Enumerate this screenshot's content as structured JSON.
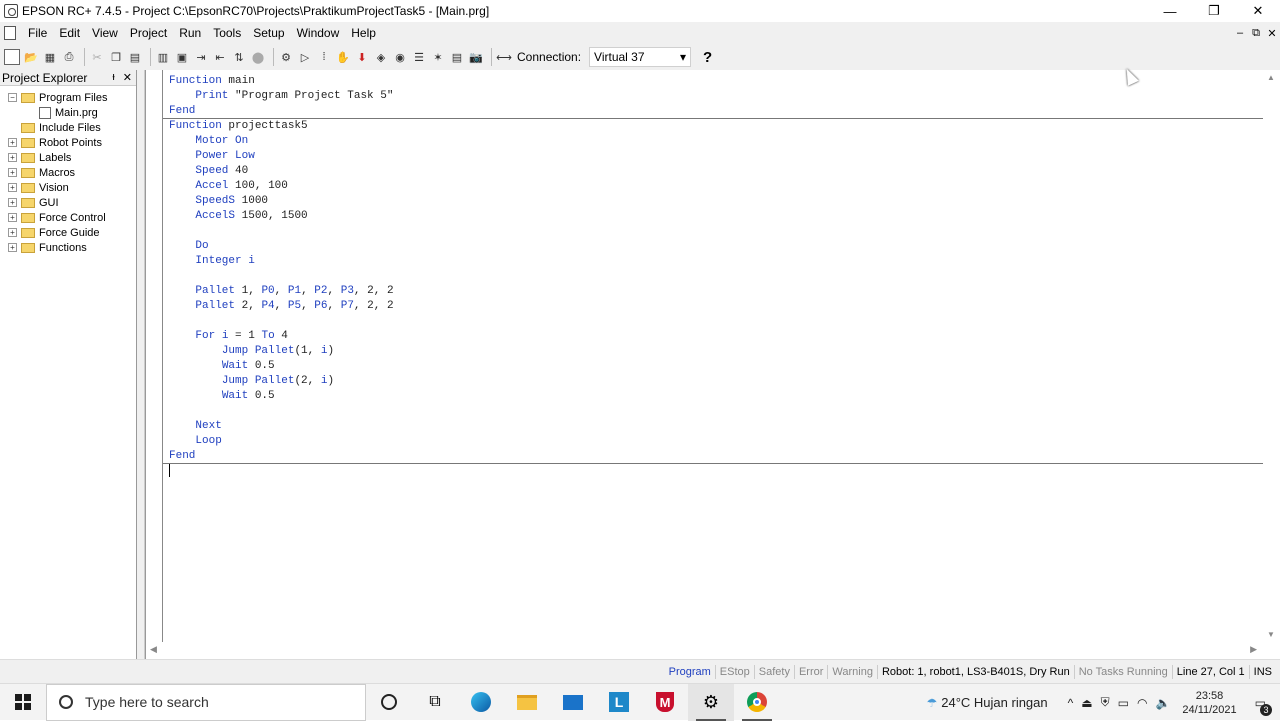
{
  "window": {
    "title": "EPSON RC+ 7.4.5 - Project C:\\EpsonRC70\\Projects\\PraktikumProjectTask5 - [Main.prg]",
    "controls": [
      "—",
      "❐",
      "✕"
    ]
  },
  "menu": {
    "items": [
      "File",
      "Edit",
      "View",
      "Project",
      "Run",
      "Tools",
      "Setup",
      "Window",
      "Help"
    ],
    "mdi_controls": [
      "‒",
      "⧉",
      "✕"
    ]
  },
  "toolbar": {
    "connection_label": "Connection:",
    "connection_value": "Virtual 37",
    "help": "?"
  },
  "explorer": {
    "title": "Project Explorer",
    "pin": "ᵼ",
    "close": "✕",
    "nodes": [
      {
        "label": "Program Files",
        "expanded": true
      },
      {
        "label": "Main.prg"
      },
      {
        "label": "Include Files"
      },
      {
        "label": "Robot Points"
      },
      {
        "label": "Labels"
      },
      {
        "label": "Macros"
      },
      {
        "label": "Vision"
      },
      {
        "label": "GUI"
      },
      {
        "label": "Force Control"
      },
      {
        "label": "Force Guide"
      },
      {
        "label": "Functions"
      }
    ]
  },
  "code": {
    "lines": [
      "Function main",
      "    Print \"Program Project Task 5\"",
      "Fend",
      "Function projecttask5",
      "    Motor On",
      "    Power Low",
      "    Speed 40",
      "    Accel 100, 100",
      "    SpeedS 1000",
      "    AccelS 1500, 1500",
      "",
      "    Do",
      "    Integer i",
      "",
      "    Pallet 1, P0, P1, P2, P3, 2, 2",
      "    Pallet 2, P4, P5, P6, P7, 2, 2",
      "",
      "    For i = 1 To 4",
      "        Jump Pallet(1, i)",
      "        Wait 0.5",
      "        Jump Pallet(2, i)",
      "        Wait 0.5",
      "",
      "    Next",
      "    Loop",
      "Fend"
    ]
  },
  "status": {
    "program": "Program",
    "estop": "EStop",
    "safety": "Safety",
    "error": "Error",
    "warning": "Warning",
    "robot": "Robot: 1, robot1, LS3-B401S, Dry Run",
    "tasks": "No Tasks Running",
    "position": "Line 27, Col 1",
    "ins": "INS"
  },
  "taskbar": {
    "search_placeholder": "Type here to search",
    "weather": "24°C  Hujan ringan",
    "time": "23:58",
    "date": "24/11/2021",
    "notif_count": "3"
  }
}
